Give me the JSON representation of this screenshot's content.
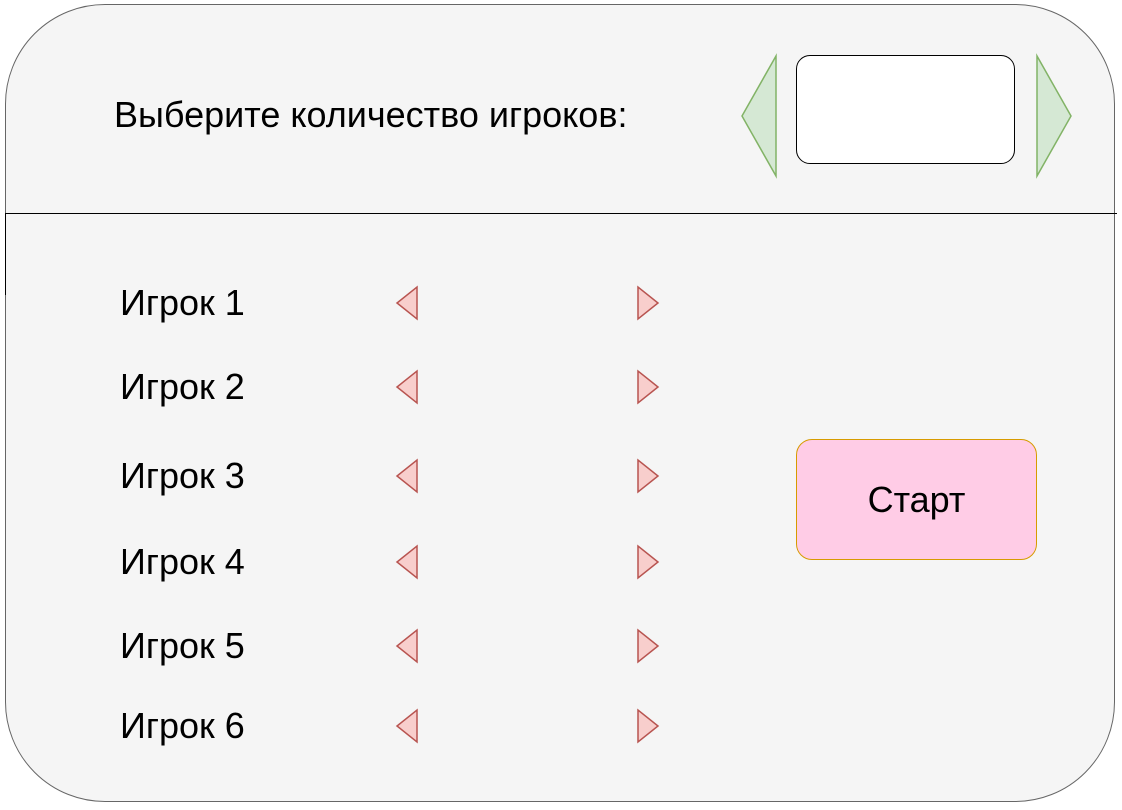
{
  "header": {
    "prompt": "Выберите количество игроков:",
    "count_value": ""
  },
  "players": [
    {
      "label": "Игрок 1",
      "value": ""
    },
    {
      "label": "Игрок 2",
      "value": ""
    },
    {
      "label": "Игрок 3",
      "value": ""
    },
    {
      "label": "Игрок 4",
      "value": ""
    },
    {
      "label": "Игрок 5",
      "value": ""
    },
    {
      "label": "Игрок 6",
      "value": ""
    }
  ],
  "start_button": {
    "label": "Старт"
  },
  "colors": {
    "panel_background": "#f5f5f5",
    "green_arrow_fill": "#d5e8d4",
    "green_arrow_stroke": "#82b366",
    "red_arrow_fill": "#f8cecc",
    "red_arrow_stroke": "#b85450",
    "start_fill": "#ffcce6",
    "start_stroke": "#d79b00"
  },
  "icons": {
    "count_decrease": "triangle-left-icon",
    "count_increase": "triangle-right-icon",
    "player_prev": "triangle-left-icon",
    "player_next": "triangle-right-icon"
  }
}
